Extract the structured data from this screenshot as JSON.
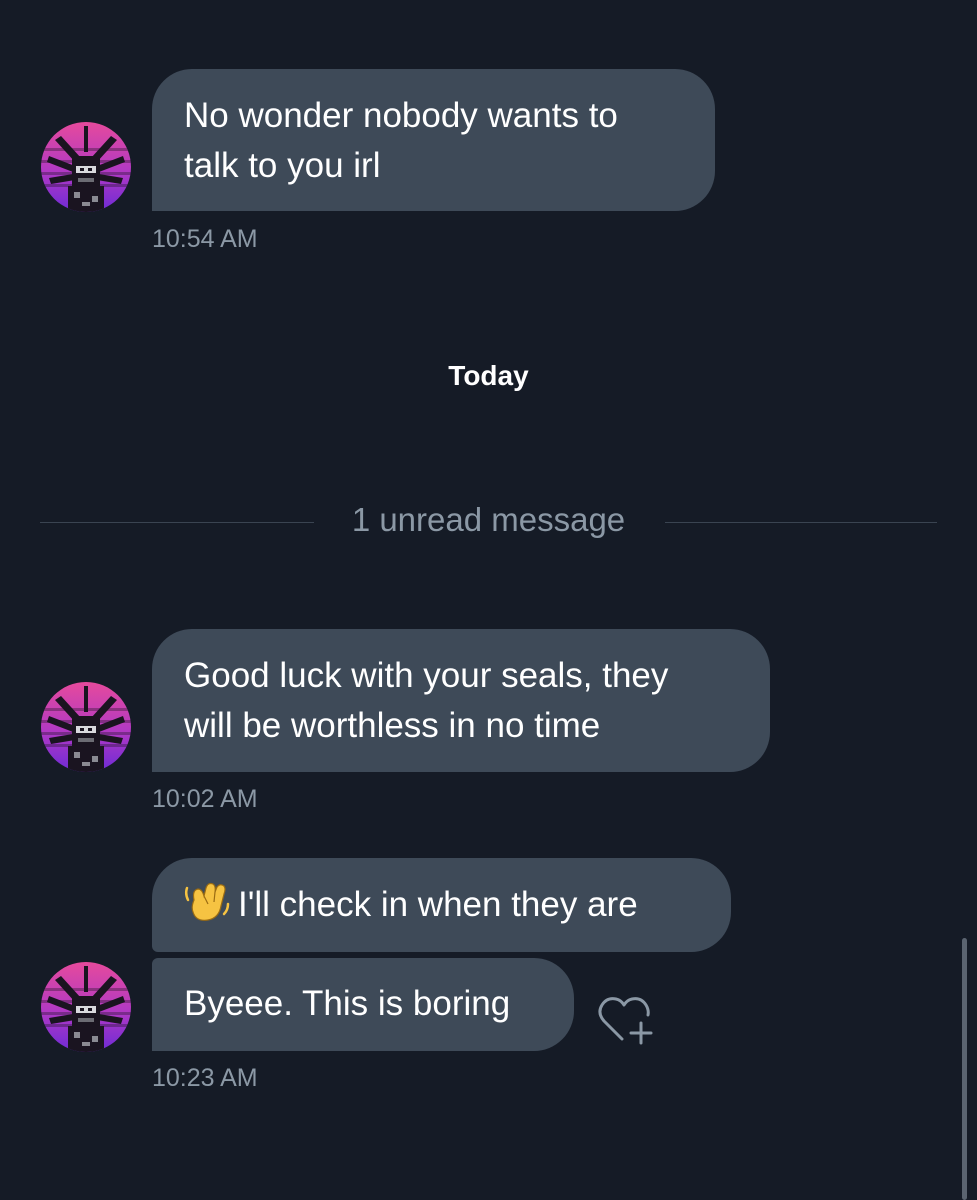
{
  "messages": [
    {
      "lines": [
        "No wonder nobody wants to",
        "talk to you irl"
      ],
      "time": "10:54 AM"
    },
    {
      "lines": [
        "Good luck with your seals, they",
        "will be worthless in no time"
      ],
      "time": "10:02 AM"
    },
    {
      "emoji_icon": "waving-hand-icon",
      "lines": [
        "I'll check in when they are"
      ]
    },
    {
      "lines": [
        "Byeee. This is boring"
      ],
      "time": "10:23 AM",
      "reaction_icon": "add-reaction-heart-icon"
    }
  ],
  "day_separator": {
    "label": "Today"
  },
  "unread_divider": {
    "label": "1 unread message"
  },
  "colors": {
    "background": "#151b26",
    "bubble": "#3e4a58",
    "muted_text": "#8b98a5",
    "divider": "#3a4451",
    "avatar_pink": "#d2408f",
    "avatar_purple": "#7a2fd0"
  }
}
